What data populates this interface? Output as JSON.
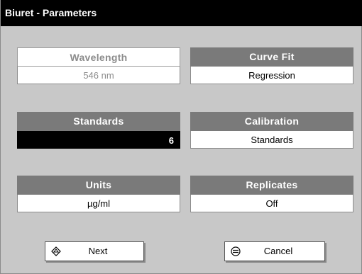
{
  "window": {
    "title": "Biuret - Parameters"
  },
  "params": {
    "wavelength": {
      "label": "Wavelength",
      "value": "546 nm"
    },
    "curve_fit": {
      "label": "Curve Fit",
      "value": "Regression"
    },
    "standards": {
      "label": "Standards",
      "value": "6"
    },
    "calibration": {
      "label": "Calibration",
      "value": "Standards"
    },
    "units": {
      "label": "Units",
      "value": "µg/ml"
    },
    "replicates": {
      "label": "Replicates",
      "value": "Off"
    }
  },
  "buttons": {
    "next": {
      "label": "Next",
      "icon": "diamond-arrow-icon"
    },
    "cancel": {
      "label": "Cancel",
      "icon": "cancel-circle-icon"
    }
  },
  "colors": {
    "header_bg": "#7a7a7a",
    "panel_bg": "#c8c8c8",
    "title_bg": "#000000"
  }
}
